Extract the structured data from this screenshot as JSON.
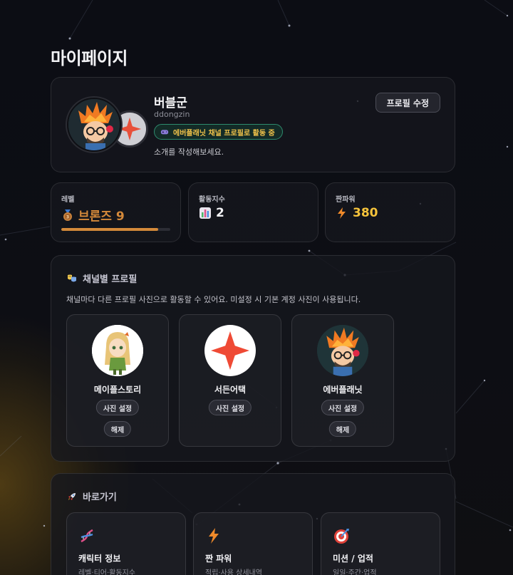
{
  "page": {
    "title": "마이페이지"
  },
  "profile": {
    "name": "버블군",
    "user_id": "ddongzin",
    "channel_badge": "에버플래닛 채널 프로필로 활동 중",
    "bio": "소개를 작성해보세요.",
    "edit_label": "프로필 수정"
  },
  "stats": {
    "level": {
      "label": "레벨",
      "value": "브론즈 9",
      "progress": 0.89,
      "icon": "bronze-medal-icon",
      "color": "#d4893a"
    },
    "activity": {
      "label": "활동지수",
      "value": "2",
      "icon": "bar-chart-icon",
      "color": "#f2f2f5"
    },
    "fan_power": {
      "label": "짠파워",
      "value": "380",
      "icon": "lightning-icon",
      "color": "#f5c33b"
    }
  },
  "channels": {
    "title": "채널별 프로필",
    "description": "채널마다 다른 프로필 사진으로 활동할 수 있어요. 미설정 시 기본 계정 사진이 사용됩니다.",
    "items": [
      {
        "name": "메이플스토리",
        "set_label": "사진 설정",
        "remove_label": "해제"
      },
      {
        "name": "서든어택",
        "set_label": "사진 설정"
      },
      {
        "name": "에버플래닛",
        "set_label": "사진 설정",
        "remove_label": "해제"
      }
    ]
  },
  "shortcuts": {
    "title": "바로가기",
    "items": [
      {
        "title": "캐릭터 정보",
        "subtitle": "레벨·티어·활동지수",
        "icon": "dna-icon"
      },
      {
        "title": "짠 파워",
        "subtitle": "적립·사용 상세내역",
        "icon": "lightning-icon"
      },
      {
        "title": "미션 / 업적",
        "subtitle": "일일·주간·업적",
        "icon": "target-icon"
      }
    ]
  }
}
